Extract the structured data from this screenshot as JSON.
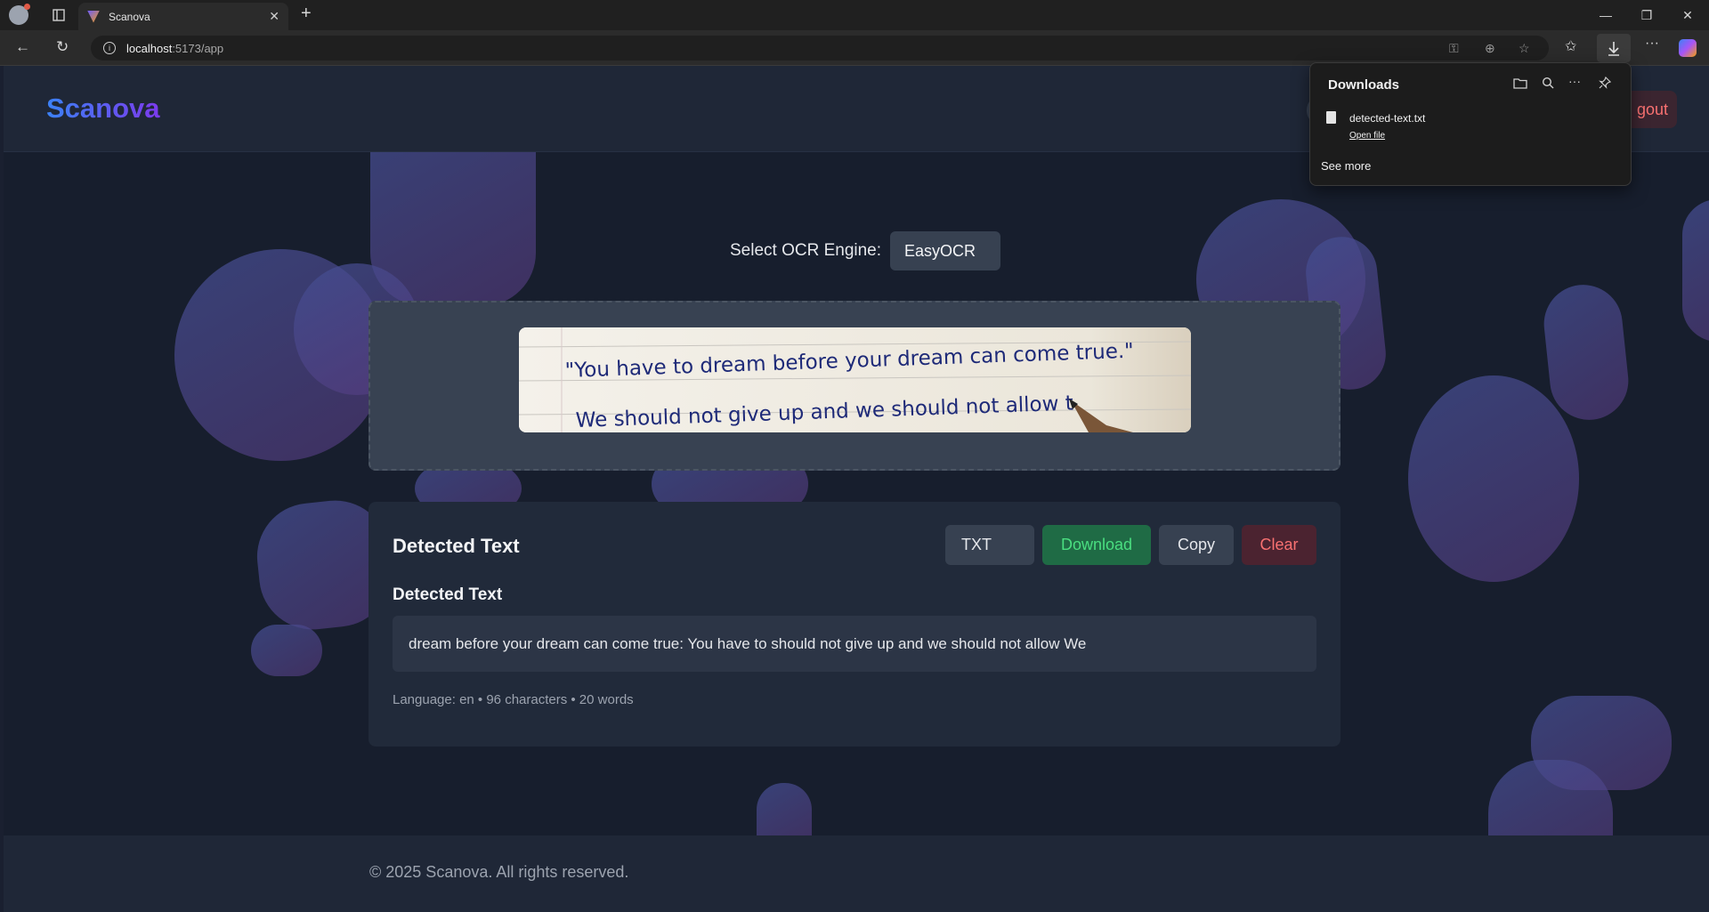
{
  "browser": {
    "tab_title": "Scanova",
    "url_host": "localhost",
    "url_path": ":5173/app"
  },
  "header": {
    "brand": "Scanova",
    "logout_label": "gout"
  },
  "engine": {
    "label": "Select OCR Engine:",
    "selected": "EasyOCR"
  },
  "preview": {
    "line1": "\"You have to dream before your dream can come true.\"",
    "line2": "We should not give up and we should not allow t"
  },
  "result": {
    "title": "Detected Text",
    "format": "TXT",
    "download_label": "Download",
    "copy_label": "Copy",
    "clear_label": "Clear",
    "subtitle": "Detected Text",
    "text": "dream before your dream can come true: You have to should not give up and we should not allow We",
    "meta": "Language: en • 96 characters • 20 words"
  },
  "footer": {
    "copyright": "© 2025 Scanova. All rights reserved."
  },
  "downloads": {
    "title": "Downloads",
    "file_name": "detected-text.txt",
    "open_file": "Open file",
    "see_more": "See more"
  }
}
